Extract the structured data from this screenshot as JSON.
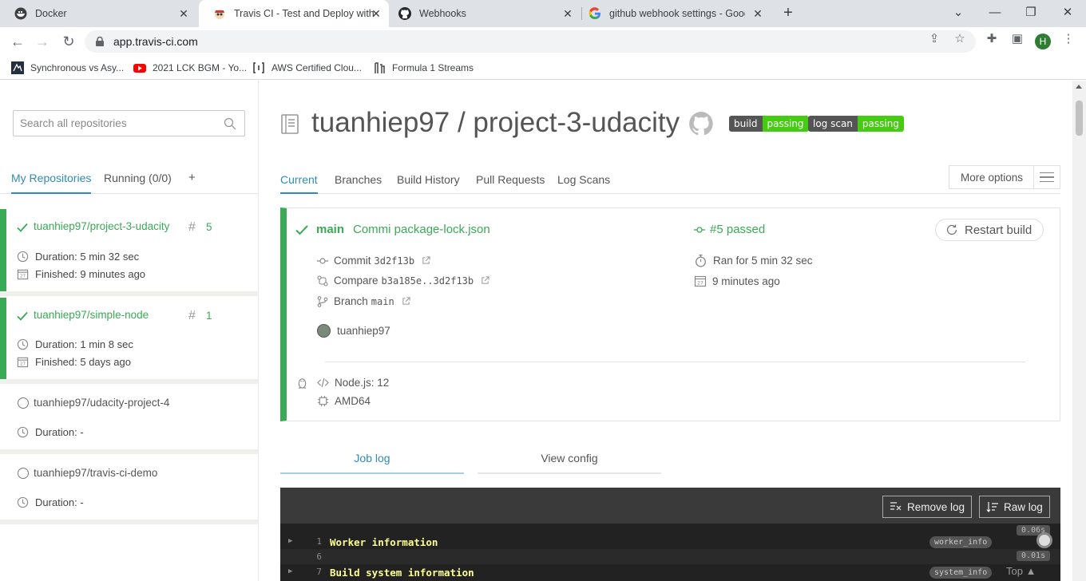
{
  "browser": {
    "tabs": [
      {
        "title": "Docker",
        "icon": "docker-icon"
      },
      {
        "title": "Travis CI - Test and Deploy with C",
        "icon": "travis-icon"
      },
      {
        "title": "Webhooks",
        "icon": "github-icon"
      },
      {
        "title": "github webhook settings - Googl",
        "icon": "google-icon"
      }
    ],
    "new_tab": "+",
    "url": "app.travis-ci.com",
    "profile_initial": "H",
    "bookmarks": [
      {
        "title": "Synchronous vs Asy...",
        "icon": "bookmark-site-icon"
      },
      {
        "title": "2021 LCK BGM - Yo...",
        "icon": "youtube-icon"
      },
      {
        "title": "AWS Certified Clou...",
        "icon": "bracket-icon"
      },
      {
        "title": "Formula 1 Streams",
        "icon": "f1-icon"
      }
    ]
  },
  "sidebar": {
    "search_placeholder": "Search all repositories",
    "tabs": {
      "my_repos": "My Repositories",
      "running": "Running (0/0)",
      "add": "+"
    },
    "repos": [
      {
        "name": "tuanhiep97/project-3-udacity",
        "status": "passed",
        "build_number": "5",
        "duration": "Duration: 5 min 32 sec",
        "finished": "Finished: 9 minutes ago"
      },
      {
        "name": "tuanhiep97/simple-node",
        "status": "passed",
        "build_number": "1",
        "duration": "Duration: 1 min 8 sec",
        "finished": "Finished: 5 days ago"
      },
      {
        "name": "tuanhiep97/udacity-project-4",
        "status": "none",
        "duration": "Duration: -"
      },
      {
        "name": "tuanhiep97/travis-ci-demo",
        "status": "none",
        "duration": "Duration: -"
      }
    ]
  },
  "repo": {
    "title": "tuanhiep97 / project-3-udacity",
    "badges": [
      {
        "label": "build",
        "value": "passing"
      },
      {
        "label": "log scan",
        "value": "passing"
      }
    ]
  },
  "navtabs": [
    "Current",
    "Branches",
    "Build History",
    "Pull Requests",
    "Log Scans"
  ],
  "more_options": "More options",
  "build": {
    "branch": "main",
    "message": "Commi package-lock.json",
    "status": "#5 passed",
    "restart": "Restart build",
    "commit_label": "Commit",
    "commit": "3d2f13b",
    "compare_label": "Compare",
    "compare": "b3a185e..3d2f13b",
    "branch_label": "Branch",
    "branch_value": "main",
    "ran_for": "Ran for 5 min 32 sec",
    "finished": "9 minutes ago",
    "author": "tuanhiep97",
    "language": "Node.js: 12",
    "arch": "AMD64"
  },
  "log": {
    "tabs": [
      "Job log",
      "View config"
    ],
    "remove": "Remove log",
    "raw": "Raw log",
    "lines": [
      {
        "num": "1",
        "text": "Worker information",
        "tag": "worker_info",
        "time": "0.06s"
      },
      {
        "num": "6",
        "text": "",
        "tag": "",
        "time": "0.01s"
      },
      {
        "num": "7",
        "text": "Build system information",
        "tag": "system_info",
        "time": ""
      }
    ],
    "top": "Top"
  },
  "colors": {
    "passed": "#39aa56",
    "accent": "#2f8cba",
    "badge_green": "#44cc11"
  }
}
